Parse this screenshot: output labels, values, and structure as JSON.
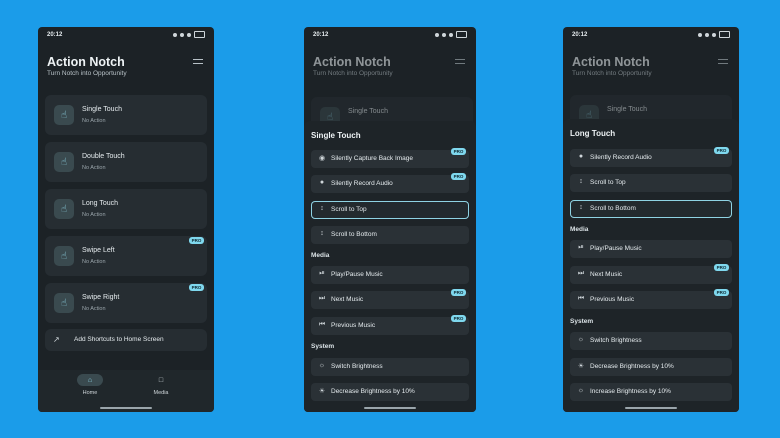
{
  "status": {
    "time": "20:12"
  },
  "app": {
    "title": "Action Notch",
    "subtitle": "Turn Notch into Opportunity"
  },
  "gestures": [
    {
      "label": "Single Touch",
      "action": "No Action",
      "pro": false
    },
    {
      "label": "Double Touch",
      "action": "No Action",
      "pro": false
    },
    {
      "label": "Long Touch",
      "action": "No Action",
      "pro": false
    },
    {
      "label": "Swipe Left",
      "action": "No Action",
      "pro": true
    },
    {
      "label": "Swipe Right",
      "action": "No Action",
      "pro": true
    }
  ],
  "pro_badge": "PRO",
  "shortcut": {
    "label": "Add Shortcuts to Home Screen"
  },
  "nav": {
    "home": "Home",
    "media": "Media"
  },
  "sheet1": {
    "title": "Single Touch",
    "items1": [
      {
        "label": "Silently Capture Back Image",
        "icon": "camera-icon",
        "pro": true,
        "selected": false
      },
      {
        "label": "Silently Record Audio",
        "icon": "mic-icon",
        "pro": true,
        "selected": false
      },
      {
        "label": "Scroll to Top",
        "icon": "scroll-icon",
        "pro": false,
        "selected": true
      },
      {
        "label": "Scroll to Bottom",
        "icon": "scroll-icon",
        "pro": false,
        "selected": false
      }
    ],
    "media_label": "Media",
    "media": [
      {
        "label": "Play/Pause Music",
        "icon": "play-pause-icon",
        "pro": false
      },
      {
        "label": "Next Music",
        "icon": "next-icon",
        "pro": true
      },
      {
        "label": "Previous Music",
        "icon": "previous-icon",
        "pro": true
      }
    ],
    "system_label": "System",
    "system": [
      {
        "label": "Switch Brightness",
        "icon": "brightness-icon",
        "pro": false
      },
      {
        "label": "Decrease Brightness by 10%",
        "icon": "brightness-low-icon",
        "pro": false
      }
    ]
  },
  "sheet2": {
    "title": "Long Touch",
    "items1": [
      {
        "label": "Silently Record Audio",
        "icon": "mic-icon",
        "pro": true,
        "selected": false
      },
      {
        "label": "Scroll to Top",
        "icon": "scroll-icon",
        "pro": false,
        "selected": false
      },
      {
        "label": "Scroll to Bottom",
        "icon": "scroll-icon",
        "pro": false,
        "selected": true
      }
    ],
    "media_label": "Media",
    "media": [
      {
        "label": "Play/Pause Music",
        "icon": "play-pause-icon",
        "pro": false
      },
      {
        "label": "Next Music",
        "icon": "next-icon",
        "pro": true
      },
      {
        "label": "Previous Music",
        "icon": "previous-icon",
        "pro": true
      }
    ],
    "system_label": "System",
    "system": [
      {
        "label": "Switch Brightness",
        "icon": "brightness-icon",
        "pro": false
      },
      {
        "label": "Decrease Brightness by 10%",
        "icon": "brightness-low-icon",
        "pro": false
      },
      {
        "label": "Increase Brightness by 10%",
        "icon": "brightness-high-icon",
        "pro": false
      }
    ]
  }
}
